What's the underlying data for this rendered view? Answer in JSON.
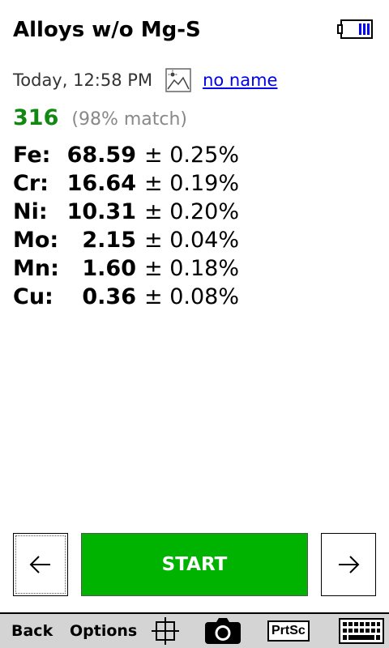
{
  "header": {
    "title": "Alloys w/o Mg-S",
    "battery_icon": "battery-full-icon"
  },
  "info": {
    "timestamp": "Today, 12:58 PM",
    "image_icon": "image-icon",
    "name_link": "no name"
  },
  "result": {
    "grade": "316",
    "match": "(98% match)",
    "grade_color": "#118811"
  },
  "elements": [
    {
      "symbol": "Fe:",
      "value": "68.59",
      "error": "± 0.25%"
    },
    {
      "symbol": "Cr:",
      "value": "16.64",
      "error": "± 0.19%"
    },
    {
      "symbol": "Ni:",
      "value": "10.31",
      "error": "± 0.20%"
    },
    {
      "symbol": "Mo:",
      "value": "2.15",
      "error": "± 0.04%"
    },
    {
      "symbol": "Mn:",
      "value": "1.60",
      "error": "± 0.18%"
    },
    {
      "symbol": "Cu:",
      "value": "0.36",
      "error": "± 0.08%"
    }
  ],
  "controls": {
    "prev_icon": "arrow-left-icon",
    "start_label": "START",
    "next_icon": "arrow-right-icon",
    "start_color": "#00b300"
  },
  "toolbar": {
    "back_label": "Back",
    "options_label": "Options",
    "crosshair_icon": "crosshair-icon",
    "camera_icon": "camera-icon",
    "prtsc_label": "PrtSc",
    "keyboard_icon": "keyboard-icon"
  }
}
